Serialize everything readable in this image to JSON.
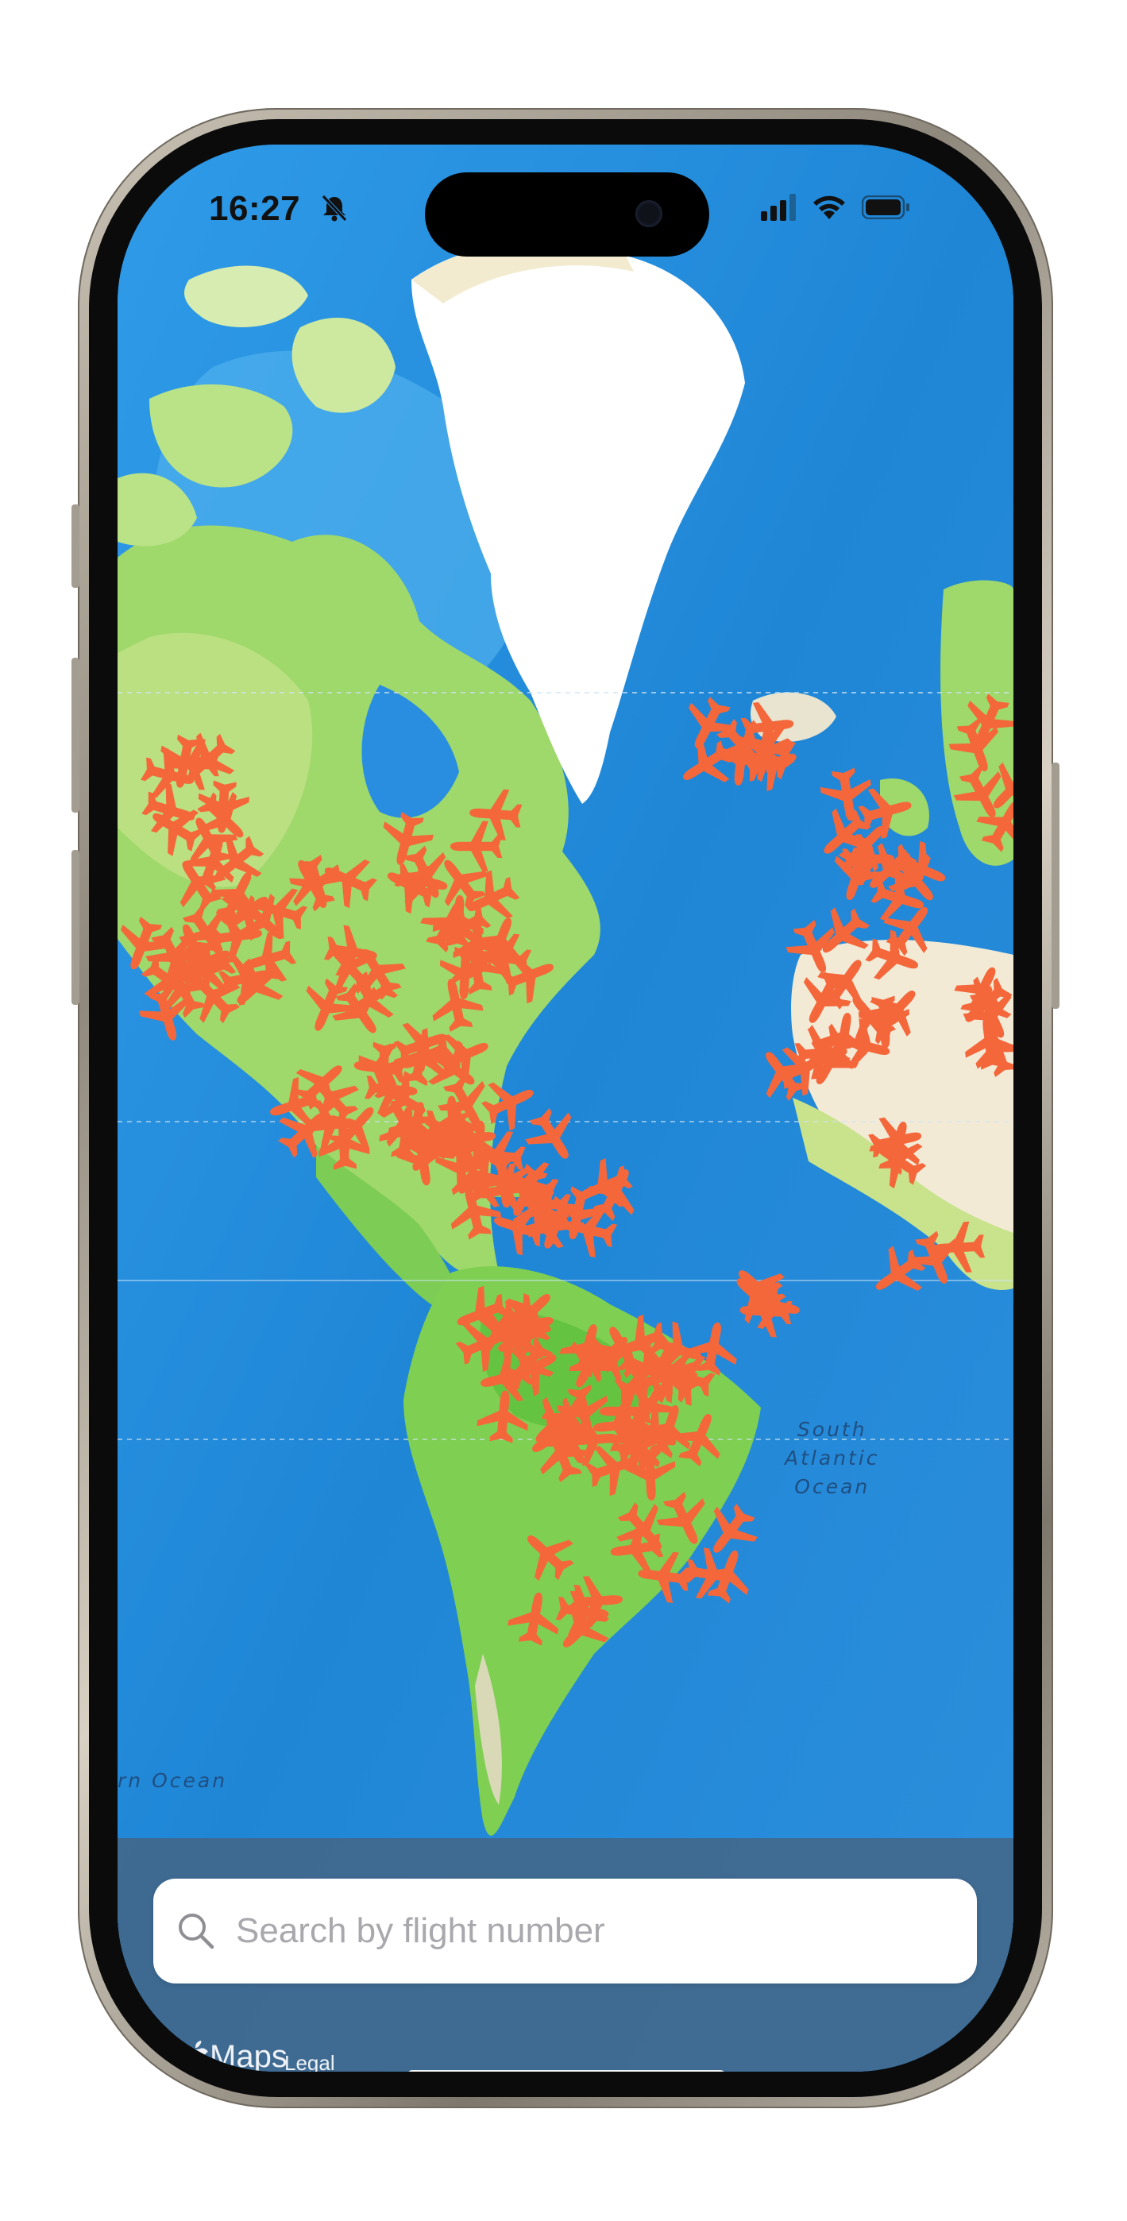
{
  "status_bar": {
    "time": "16:27"
  },
  "map": {
    "labels": {
      "south_atlantic_line1": "South",
      "south_atlantic_line2": "Atlantic",
      "south_atlantic_line3": "Ocean",
      "pacific_partial": "rn Ocean"
    },
    "plane_color": "#F4673B",
    "ocean_color": "#2A8EE0",
    "land_color": "#9FD86B",
    "ice_color": "#FFFFFF"
  },
  "search": {
    "placeholder": "Search by flight number",
    "value": ""
  },
  "footer": {
    "maps_label": "Maps",
    "legal_label": "Legal"
  },
  "icons": {
    "search": "magnifier-icon",
    "plane": "airplane-icon",
    "mute": "bell-slash-icon",
    "signal": "cellular-signal-icon",
    "wifi": "wifi-icon",
    "battery": "battery-icon",
    "apple": "apple-logo-icon"
  }
}
